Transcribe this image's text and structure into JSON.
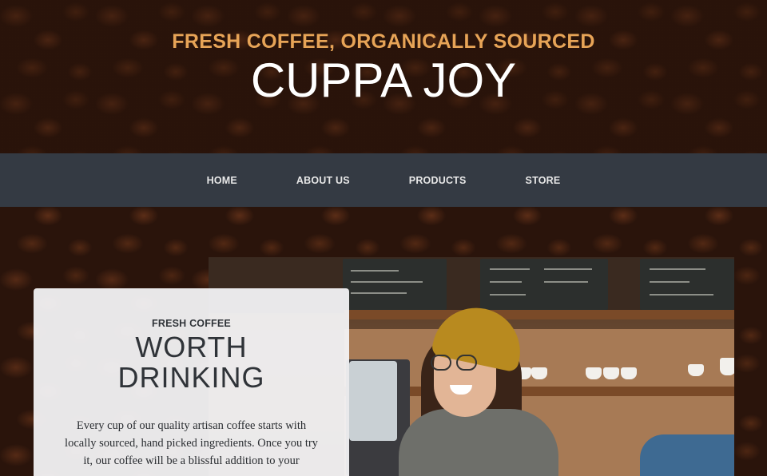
{
  "hero": {
    "tagline": "FRESH COFFEE, ORGANICALLY SOURCED",
    "brand": "CUPPA JOY"
  },
  "nav": {
    "items": [
      {
        "label": "HOME"
      },
      {
        "label": "ABOUT US"
      },
      {
        "label": "PRODUCTS"
      },
      {
        "label": "STORE"
      }
    ]
  },
  "feature": {
    "eyebrow": "FRESH COFFEE",
    "heading_line1": "WORTH",
    "heading_line2": "DRINKING",
    "body": "Every cup of our quality artisan coffee starts with locally sourced, hand picked ingredients. Once you try it, our coffee will be a blissful addition to your"
  },
  "colors": {
    "accent": "#e7a457",
    "nav_bg": "#343a43",
    "card_bg": "#f4f4f6"
  }
}
